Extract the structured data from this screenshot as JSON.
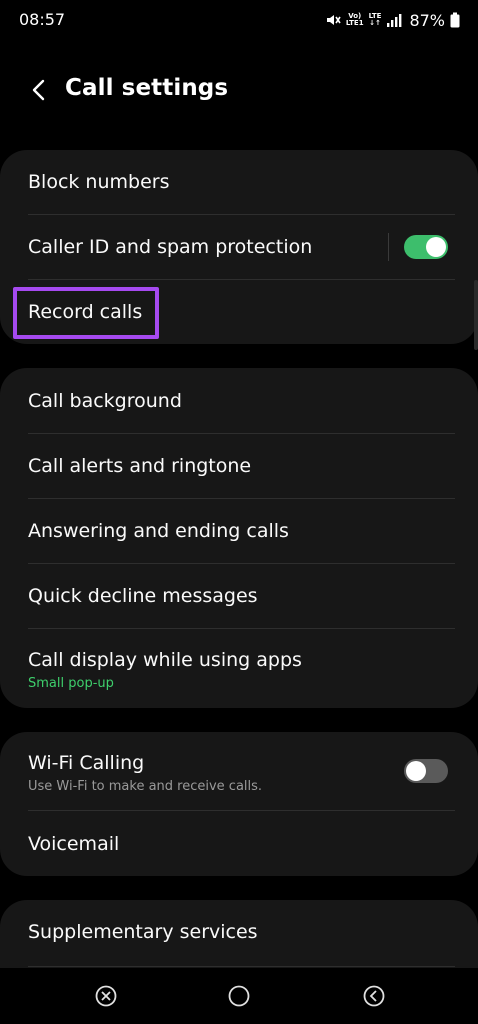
{
  "status_bar": {
    "time": "08:57",
    "network_top": "Vo)",
    "network_bottom": "LTE1",
    "lte_label": "LTE",
    "battery": "87%"
  },
  "header": {
    "title": "Call settings",
    "back_icon": "chevron-left-icon"
  },
  "groups": [
    {
      "items": [
        {
          "label": "Block numbers"
        },
        {
          "label": "Caller ID and spam protection",
          "toggle": true
        },
        {
          "label": "Record calls",
          "highlighted": true
        }
      ]
    },
    {
      "items": [
        {
          "label": "Call background"
        },
        {
          "label": "Call alerts and ringtone"
        },
        {
          "label": "Answering and ending calls"
        },
        {
          "label": "Quick decline messages"
        },
        {
          "label": "Call display while using apps",
          "sub": "Small pop-up"
        }
      ]
    },
    {
      "items": [
        {
          "label": "Wi-Fi Calling",
          "sub": "Use Wi-Fi to make and receive calls.",
          "toggle": false
        },
        {
          "label": "Voicemail"
        }
      ]
    },
    {
      "items": [
        {
          "label": "Supplementary services"
        }
      ]
    }
  ],
  "colors": {
    "background": "#000000",
    "card": "#171717",
    "accent_green": "#3dbe6c",
    "highlight": "#a64af0"
  },
  "nav": {
    "recents_icon": "close-circle-icon",
    "home_icon": "home-circle-icon",
    "back_icon": "back-circle-icon"
  }
}
